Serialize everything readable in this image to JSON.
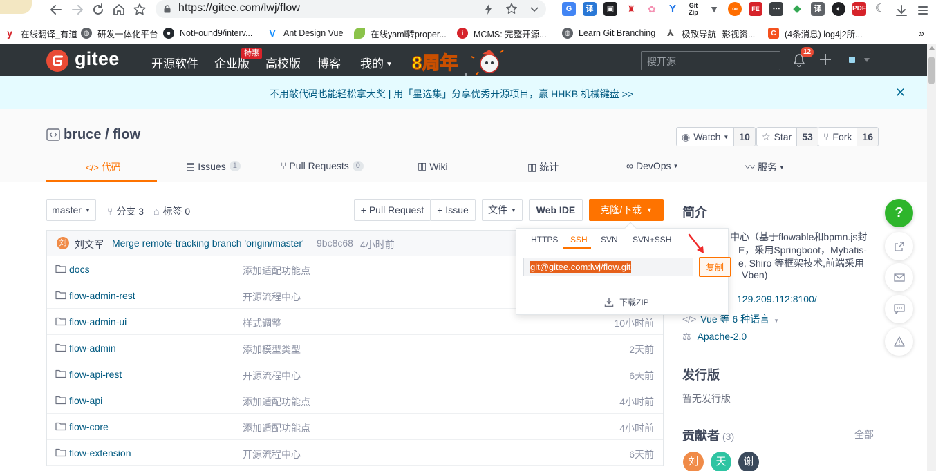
{
  "browser": {
    "url": "https://gitee.com/lwj/flow",
    "bookmarks": [
      {
        "label": "在线翻译_有道",
        "icon": "youdao-icon",
        "color": "#d6232a"
      },
      {
        "label": "研发一体化平台",
        "icon": "globe-icon",
        "color": "#5f6368"
      },
      {
        "label": "NotFound9/interv...",
        "icon": "github-icon",
        "color": "#24292e"
      },
      {
        "label": "Ant Design Vue",
        "icon": "antd-icon",
        "color": "#1890ff"
      },
      {
        "label": "在线yaml转proper...",
        "icon": "leaf-icon",
        "color": "#8bc34a"
      },
      {
        "label": "MCMS: 完整开源...",
        "icon": "mcms-icon",
        "color": "#d6232a"
      },
      {
        "label": "Learn Git Branching",
        "icon": "globe-icon",
        "color": "#5f6368"
      },
      {
        "label": "极致导航--影视资...",
        "icon": "nav-icon",
        "color": "#555555"
      },
      {
        "label": "(4条消息) log4j2所...",
        "icon": "csdn-icon",
        "color": "#f4511e"
      }
    ],
    "more_bookmarks": "»"
  },
  "navbar": {
    "brand": "gitee",
    "menu": [
      "开源软件",
      "企业版",
      "高校版",
      "博客",
      "我的"
    ],
    "enterprise_badge": "特惠",
    "anniversary": "8周年",
    "search_placeholder": "搜开源",
    "notification_count": "12"
  },
  "banner": {
    "text": "不用敲代码也能轻松拿大奖 | 用「星选集」分享优秀开源项目，赢 HHKB 机械键盘 >>",
    "close": "✕"
  },
  "repo": {
    "owner": "bruce",
    "name": "flow",
    "title": "bruce / flow",
    "watch_label": "Watch",
    "watch_count": "10",
    "star_label": "Star",
    "star_count": "53",
    "fork_label": "Fork",
    "fork_count": "16"
  },
  "tabs": {
    "code": "代码",
    "issues": "Issues",
    "issues_count": "1",
    "pull_requests": "Pull Requests",
    "pull_requests_count": "0",
    "wiki": "Wiki",
    "stats": "统计",
    "devops": "DevOps",
    "service": "服务"
  },
  "toolbar": {
    "branch": "master",
    "branches": "分支 3",
    "tags": "标签 0",
    "pull_request": "+ Pull Request",
    "issue": "+ Issue",
    "file": "文件",
    "web_ide": "Web IDE",
    "clone": "克隆/下载"
  },
  "commit": {
    "avatar": "刘",
    "author": "刘文军",
    "message": "Merge remote-tracking branch 'origin/master'",
    "hash": "9bc8c68",
    "time": "4小时前"
  },
  "files": [
    {
      "name": "docs",
      "message": "添加适配功能点",
      "time": ""
    },
    {
      "name": "flow-admin-rest",
      "message": "开源流程中心",
      "time": ""
    },
    {
      "name": "flow-admin-ui",
      "message": "样式调整",
      "time": "10小时前"
    },
    {
      "name": "flow-admin",
      "message": "添加模型类型",
      "time": "2天前"
    },
    {
      "name": "flow-api-rest",
      "message": "开源流程中心",
      "time": "6天前"
    },
    {
      "name": "flow-api",
      "message": "添加适配功能点",
      "time": "4小时前"
    },
    {
      "name": "flow-core",
      "message": "添加适配功能点",
      "time": "4小时前"
    },
    {
      "name": "flow-extension",
      "message": "开源流程中心",
      "time": "6天前"
    }
  ],
  "clone_popup": {
    "tabs": [
      "HTTPS",
      "SSH",
      "SVN",
      "SVN+SSH"
    ],
    "active_tab": "SSH",
    "url": "git@gitee.com:lwj/flow.git",
    "copy": "复制",
    "download_zip": "下载ZIP"
  },
  "sidebar": {
    "intro_title": "简介",
    "intro_lines": [
      "中心（基于flowable和bpmn.js封",
      "E，采用Springboot，Mybatis-",
      "e, Shiro 等框架技术,前端采用",
      "Vben)"
    ],
    "website": "129.209.112:8100/",
    "languages": "Vue 等 6 种语言",
    "license": "Apache-2.0",
    "releases_title": "发行版",
    "no_releases": "暂无发行版",
    "contributors_title": "贡献者",
    "contributors_count": "(3)",
    "contributors_all": "全部",
    "contributors": [
      {
        "initial": "刘",
        "color": "#f08b48"
      },
      {
        "initial": "天",
        "color": "#2ec4a2"
      },
      {
        "initial": "谢",
        "color": "#3b4a5c"
      }
    ]
  },
  "float_help": "?",
  "colors": {
    "accent": "#fe7300",
    "navbar": "#2f3539",
    "link": "#005980",
    "help": "#2eb52b"
  }
}
